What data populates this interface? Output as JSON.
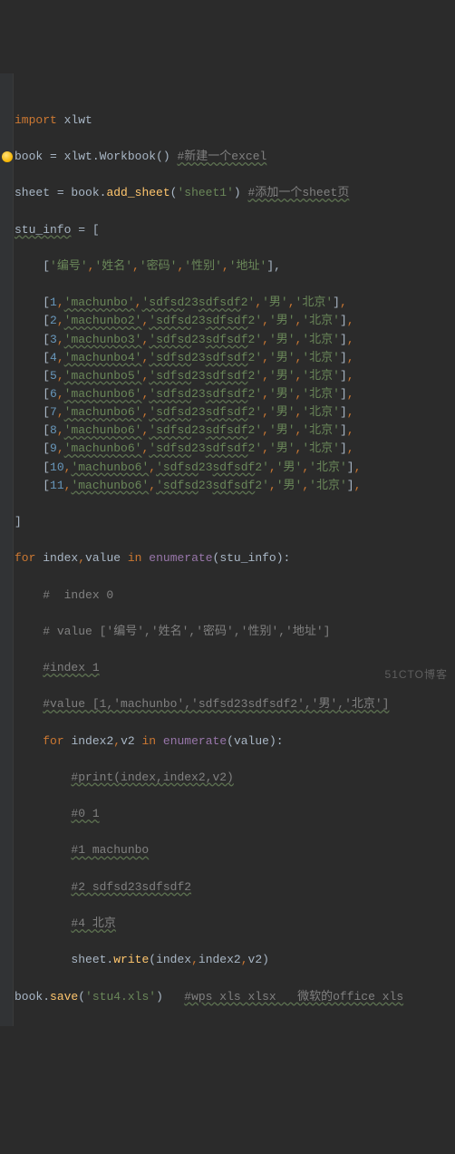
{
  "code": {
    "l1": {
      "kw": "import",
      "mod": "xlwt"
    },
    "l2": {
      "var": "book",
      "eq": "= ",
      "rhs": "xlwt.",
      "cls": "Workbook",
      "call": "()",
      "cmt": "#新建一个excel"
    },
    "l3": {
      "var": "sheet",
      "eq": "= book.",
      "fn": "add_sheet",
      "open": "(",
      "str": "'sheet1'",
      "close": ")",
      "cmt": "#添加一个sheet页"
    },
    "l4": {
      "var": "stu_info",
      "eq": " = ["
    },
    "header": {
      "open": "    [",
      "a": "'编号'",
      "b": "'姓名'",
      "c": "'密码'",
      "d": "'性别'",
      "e": "'地址'",
      "close": "],"
    },
    "rows": [
      {
        "n": "1",
        "name": "'machunbo'",
        "pw_a": "'sdfsd",
        "pw_n": "23",
        "pw_b": "sdfsdf",
        "pw_c": "2'",
        "sex": "'男'",
        "city": "'北京'"
      },
      {
        "n": "2",
        "name": "'machunbo2'",
        "pw_a": "'sdfsd",
        "pw_n": "23",
        "pw_b": "sdfsdf",
        "pw_c": "2'",
        "sex": "'男'",
        "city": "'北京'"
      },
      {
        "n": "3",
        "name": "'machunbo3'",
        "pw_a": "'sdfsd",
        "pw_n": "23",
        "pw_b": "sdfsdf",
        "pw_c": "2'",
        "sex": "'男'",
        "city": "'北京'"
      },
      {
        "n": "4",
        "name": "'machunbo4'",
        "pw_a": "'sdfsd",
        "pw_n": "23",
        "pw_b": "sdfsdf",
        "pw_c": "2'",
        "sex": "'男'",
        "city": "'北京'"
      },
      {
        "n": "5",
        "name": "'machunbo5'",
        "pw_a": "'sdfsd",
        "pw_n": "23",
        "pw_b": "sdfsdf",
        "pw_c": "2'",
        "sex": "'男'",
        "city": "'北京'"
      },
      {
        "n": "6",
        "name": "'machunbo6'",
        "pw_a": "'sdfsd",
        "pw_n": "23",
        "pw_b": "sdfsdf",
        "pw_c": "2'",
        "sex": "'男'",
        "city": "'北京'"
      },
      {
        "n": "7",
        "name": "'machunbo6'",
        "pw_a": "'sdfsd",
        "pw_n": "23",
        "pw_b": "sdfsdf",
        "pw_c": "2'",
        "sex": "'男'",
        "city": "'北京'"
      },
      {
        "n": "8",
        "name": "'machunbo6'",
        "pw_a": "'sdfsd",
        "pw_n": "23",
        "pw_b": "sdfsdf",
        "pw_c": "2'",
        "sex": "'男'",
        "city": "'北京'"
      },
      {
        "n": "9",
        "name": "'machunbo6'",
        "pw_a": "'sdfsd",
        "pw_n": "23",
        "pw_b": "sdfsdf",
        "pw_c": "2'",
        "sex": "'男'",
        "city": "'北京'"
      },
      {
        "n": "10",
        "name": "'machunbo6'",
        "pw_a": "'sdfsd",
        "pw_n": "23",
        "pw_b": "sdfsdf",
        "pw_c": "2'",
        "sex": "'男'",
        "city": "'北京'"
      },
      {
        "n": "11",
        "name": "'machunbo6'",
        "pw_a": "'sdfsd",
        "pw_n": "23",
        "pw_b": "sdfsdf",
        "pw_c": "2'",
        "sex": "'男'",
        "city": "'北京'"
      }
    ],
    "close_list": "]",
    "loop1": {
      "kw_for": "for",
      "v1": "index",
      "c": ",",
      "v2": "value",
      "kw_in": "in",
      "fn": "enumerate",
      "open": "(",
      "arg": "stu_info",
      "close": "):"
    },
    "cmt_block": {
      "c1": "#  index 0",
      "c2": "# value ['编号','姓名','密码','性别','地址']",
      "c3": "#index 1",
      "c4": "#value [1,'machunbo','sdfsd23sdfsdf2','男','北京']"
    },
    "loop2": {
      "kw_for": "for",
      "v1": "index2",
      "c": ",",
      "v2": "v2",
      "kw_in": "in",
      "fn": "enumerate",
      "open": "(",
      "arg": "value",
      "close": "):"
    },
    "cmt_block2": {
      "c1": "#print(index,index2,v2)",
      "c2": "#0 1",
      "c3": "#1 machunbo",
      "c4": "#2 sdfsd23sdfsdf2",
      "c5": "#4 北京"
    },
    "write": {
      "obj": "sheet.",
      "fn": "write",
      "open": "(",
      "a1": "index",
      "c1": ",",
      "a2": "index2",
      "c2": ",",
      "a3": "v2",
      "close": ")"
    },
    "save": {
      "obj": "book.",
      "fn": "save",
      "open": "(",
      "str": "'stu4.xls'",
      "close": ")",
      "cmt": "#wps xls xlsx   微软的office xls"
    }
  },
  "watermark": "51CTO博客"
}
